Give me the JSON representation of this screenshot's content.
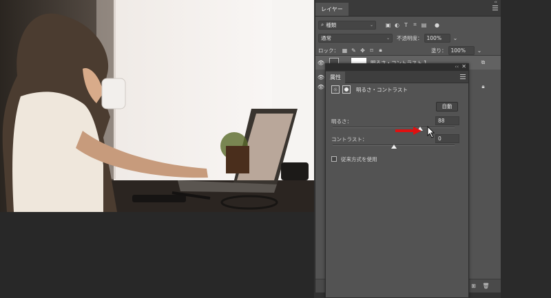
{
  "layers_panel": {
    "tab_label": "レイヤー",
    "filter_label": "種類",
    "blend_mode": "通常",
    "opacity_label": "不透明度：",
    "opacity_value": "100%",
    "lock_label": "ロック：",
    "fill_label": "塗り：",
    "fill_value": "100%",
    "layers": [
      {
        "name": "明るさ・コントラスト 1"
      }
    ]
  },
  "properties_panel": {
    "tab_label": "属性",
    "adjustment_title": "明るさ・コントラスト",
    "auto_button": "自動",
    "brightness_label": "明るさ：",
    "brightness_value": "88",
    "brightness_level": 0.72,
    "contrast_label": "コントラスト：",
    "contrast_value": "0",
    "contrast_level": 0.5,
    "legacy_label": "従来方式を使用"
  },
  "annotation": {
    "arrow_color": "#e01010"
  }
}
